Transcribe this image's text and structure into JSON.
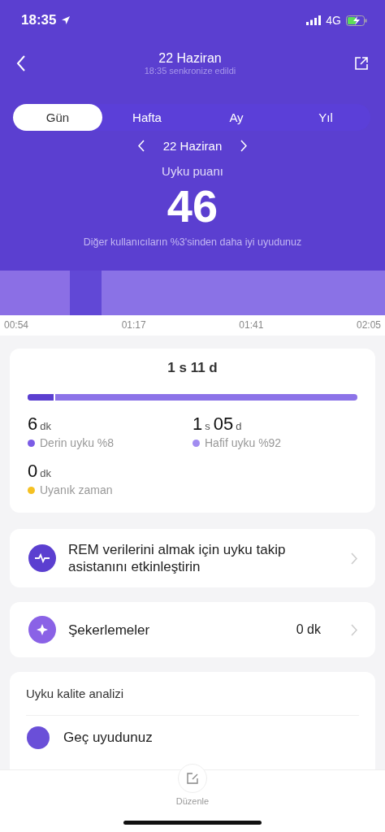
{
  "status_bar": {
    "time": "18:35",
    "network": "4G"
  },
  "header": {
    "title": "22 Haziran",
    "subtitle": "18:35 senkronize edildi"
  },
  "tabs": [
    {
      "label": "Gün",
      "selected": true
    },
    {
      "label": "Hafta",
      "selected": false
    },
    {
      "label": "Ay",
      "selected": false
    },
    {
      "label": "Yıl",
      "selected": false
    }
  ],
  "date_nav": {
    "label": "22 Haziran"
  },
  "score": {
    "label": "Uyku puanı",
    "value": "46",
    "comparison": "Diğer kullanıcıların %3'sinden daha iyi uyudunuz"
  },
  "timeline": {
    "labels": [
      "00:54",
      "01:17",
      "01:41",
      "02:05"
    ]
  },
  "summary": {
    "total": {
      "hours": "1",
      "hours_unit": "s",
      "minutes": "11",
      "minutes_unit": "d"
    },
    "bar": {
      "level": 0.08
    },
    "stats": [
      {
        "value": "6",
        "unit": "dk",
        "label": "Derin uyku %8",
        "color": "#7b5ce6"
      },
      {
        "value": "1",
        "unit": "s",
        "value2": "05",
        "unit2": "d",
        "label": "Hafif uyku %92",
        "color": "#a18cf0"
      },
      {
        "value": "0",
        "unit": "dk",
        "label": "Uyanık zaman",
        "color": "#f5c123"
      }
    ]
  },
  "rem_card": {
    "text": "REM verilerini almak için uyku takip asistanını etkinleştirin"
  },
  "naps_card": {
    "label": "Şekerlemeler",
    "value": "0",
    "unit": "dk"
  },
  "analysis": {
    "title": "Uyku kalite analizi",
    "items": [
      {
        "label": "Geç uyudunuz"
      }
    ]
  },
  "bottom_bar": {
    "label": "Düzenle"
  }
}
